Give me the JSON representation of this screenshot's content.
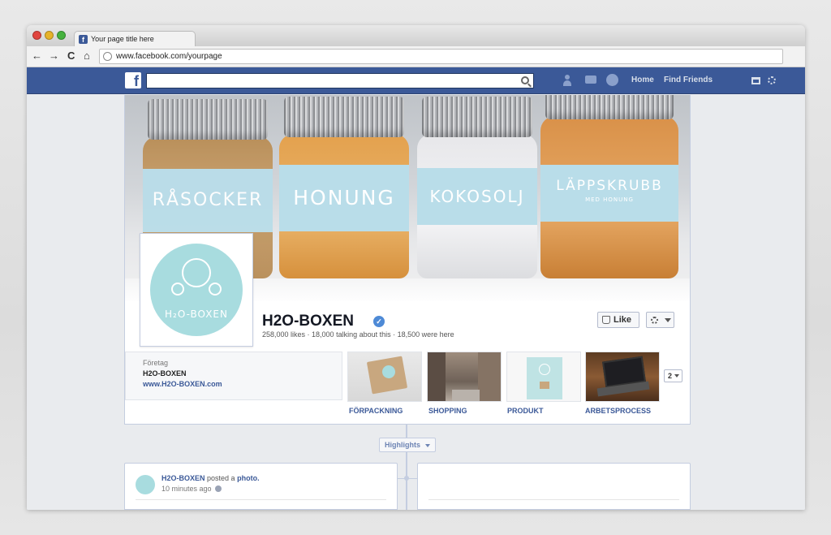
{
  "browser": {
    "tab_title": "Your page title here",
    "url": "www.facebook.com/yourpage",
    "nav": {
      "back": "←",
      "forward": "→",
      "reload": "C",
      "home": "⌂"
    }
  },
  "fb_header": {
    "logo": "f",
    "search_placeholder": "",
    "links": {
      "home": "Home",
      "find_friends": "Find Friends"
    }
  },
  "cover": {
    "jars": [
      {
        "label": "RÅSOCKER"
      },
      {
        "label": "HONUNG"
      },
      {
        "label": "KOKOSOLJ"
      },
      {
        "label": "LÄPPSKRUBB",
        "sublabel": "MED HONUNG"
      }
    ]
  },
  "profile": {
    "logo_text": "H₂O-BOXEN"
  },
  "page": {
    "name": "H2O-BOXEN",
    "verified_mark": "✓",
    "stats": "258,000 likes · 18,000 talking about this · 18,500 were here",
    "like_label": "Like"
  },
  "about": {
    "category": "Företag",
    "name": "H2O-BOXEN",
    "url": "www.H2O-BOXEN.com"
  },
  "apps": [
    {
      "label": "FÖRPACKNING"
    },
    {
      "label": "SHOPPING"
    },
    {
      "label": "PRODUKT"
    },
    {
      "label": "ARBETSPROCESS"
    }
  ],
  "more_apps_count": "2",
  "highlights_label": "Highlights",
  "post": {
    "author": "H2O-BOXEN",
    "action": "posted a",
    "object": "photo.",
    "time": "10 minutes ago"
  },
  "colors": {
    "fb_blue": "#3b5998",
    "brand_teal": "#a8dcdf",
    "label_blue": "#b9dde9"
  }
}
